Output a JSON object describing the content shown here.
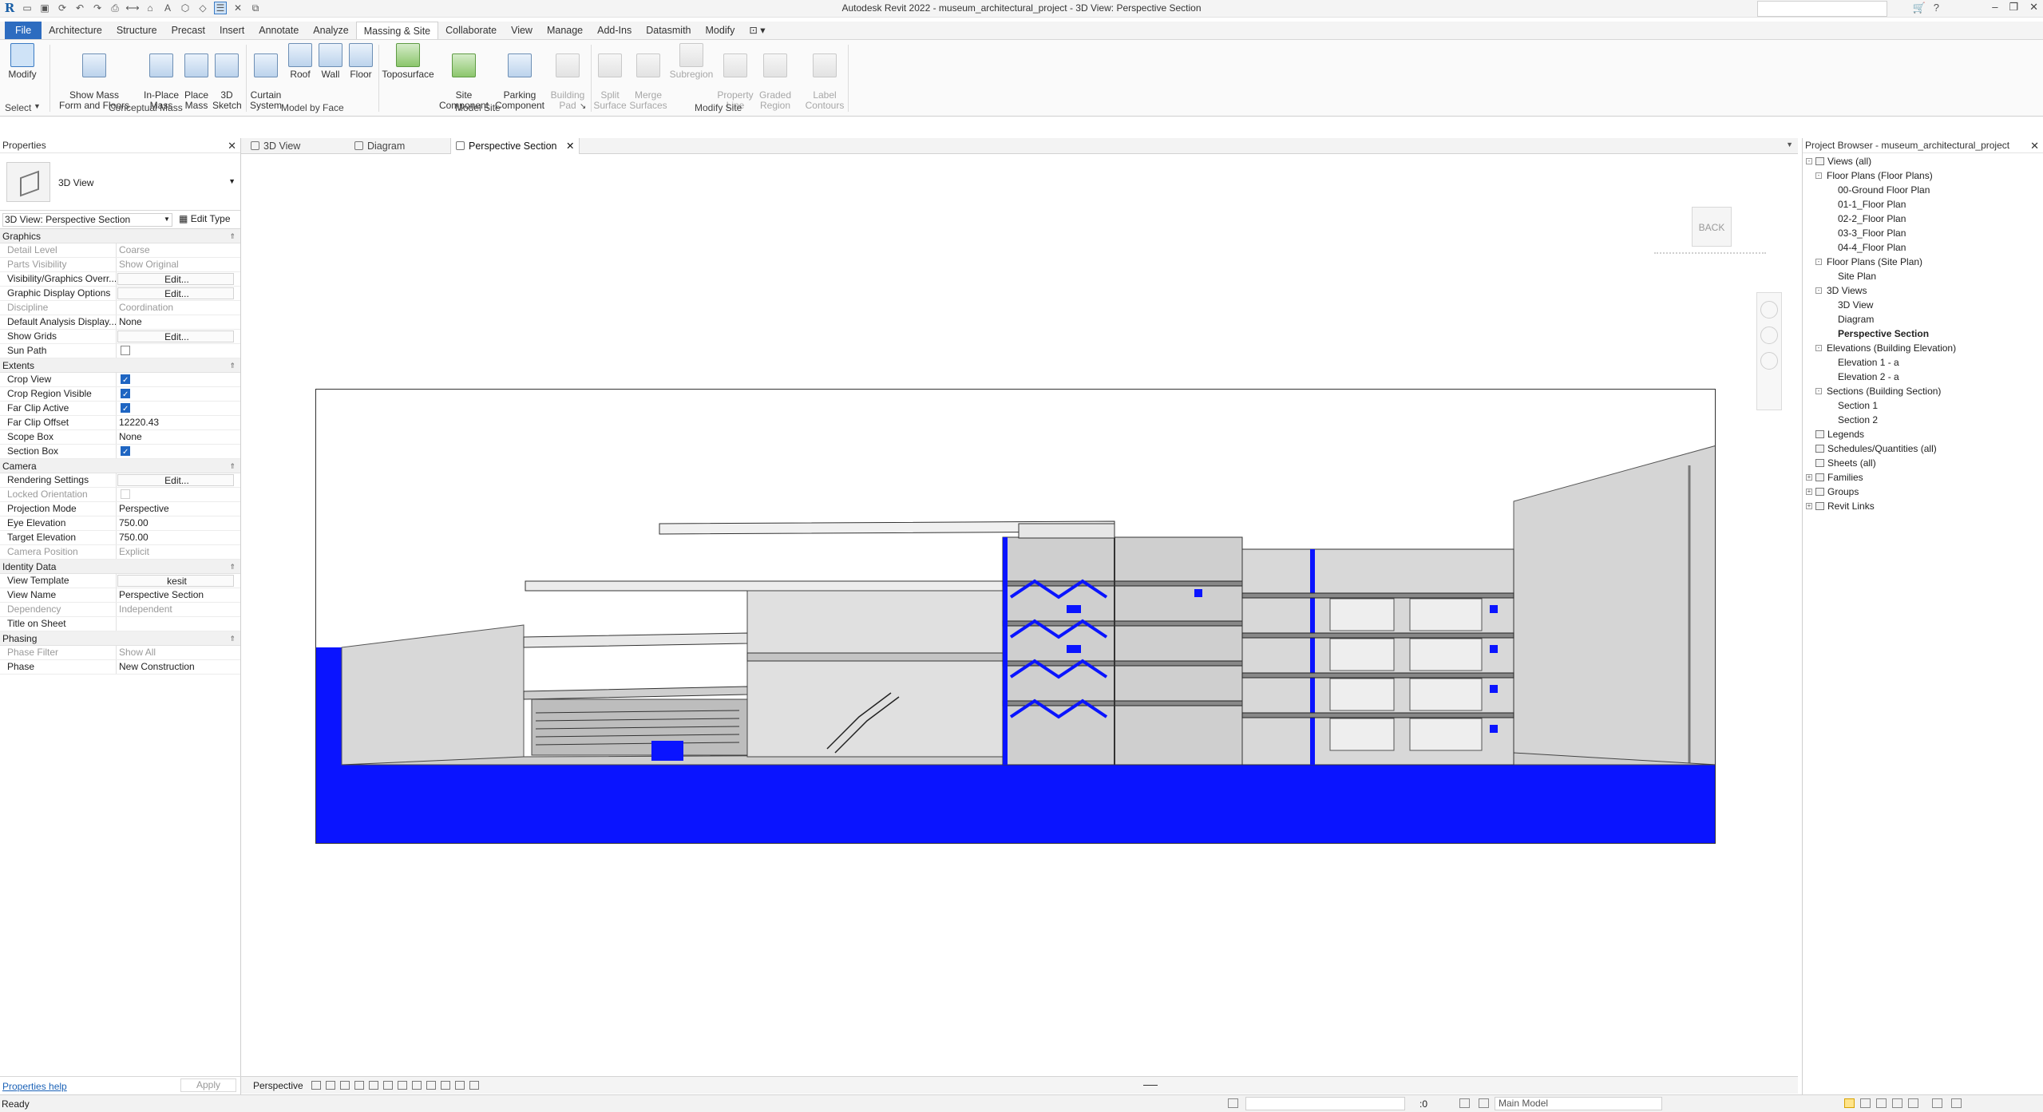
{
  "window": {
    "title": "Autodesk Revit 2022 - museum_architectural_project - 3D View: Perspective Section"
  },
  "menu": {
    "file": "File",
    "tabs": [
      "Architecture",
      "Structure",
      "Precast",
      "Insert",
      "Annotate",
      "Analyze",
      "Massing & Site",
      "Collaborate",
      "View",
      "Manage",
      "Add-Ins",
      "Datasmith",
      "Modify"
    ],
    "active": "Massing & Site"
  },
  "ribbon": {
    "modify": "Modify",
    "select": "Select",
    "conceptual_mass": {
      "label": "Conceptual Mass",
      "show_mass": "Show Mass\nForm and Floors",
      "in_place": "In-Place\nMass",
      "place_mass": "Place\nMass",
      "sketch3d": "3D\nSketch"
    },
    "model_by_face": {
      "label": "Model by Face",
      "curtain": "Curtain\nSystem",
      "roof": "Roof",
      "wall": "Wall",
      "floor": "Floor"
    },
    "model_site": {
      "label": "Model Site",
      "toposurface": "Toposurface",
      "site_component": "Site\nComponent",
      "parking": "Parking\nComponent",
      "building_pad": "Building\nPad"
    },
    "modify_site": {
      "label": "Modify Site",
      "split": "Split\nSurface",
      "merge": "Merge\nSurfaces",
      "subregion": "Subregion",
      "property_line": "Property\nLine",
      "graded": "Graded\nRegion",
      "label_contours": "Label\nContours"
    }
  },
  "properties": {
    "title": "Properties",
    "type_name": "3D View",
    "view_selector": "3D View: Perspective Section",
    "edit_type": "Edit Type",
    "groups": [
      {
        "name": "Graphics",
        "rows": [
          {
            "k": "Detail Level",
            "v": "Coarse",
            "dim": true
          },
          {
            "k": "Parts Visibility",
            "v": "Show Original",
            "dim": true
          },
          {
            "k": "Visibility/Graphics Overr...",
            "v": "Edit...",
            "btn": true
          },
          {
            "k": "Graphic Display Options",
            "v": "Edit...",
            "btn": true
          },
          {
            "k": "Discipline",
            "v": "Coordination",
            "dim": true
          },
          {
            "k": "Default Analysis Display...",
            "v": "None"
          },
          {
            "k": "Show Grids",
            "v": "Edit...",
            "btn": true
          },
          {
            "k": "Sun Path",
            "chk": "off"
          }
        ]
      },
      {
        "name": "Extents",
        "rows": [
          {
            "k": "Crop View",
            "chk": "on"
          },
          {
            "k": "Crop Region Visible",
            "chk": "on"
          },
          {
            "k": "Far Clip Active",
            "chk": "on"
          },
          {
            "k": "Far Clip Offset",
            "v": "12220.43"
          },
          {
            "k": "Scope Box",
            "v": "None"
          },
          {
            "k": "Section Box",
            "chk": "on"
          }
        ]
      },
      {
        "name": "Camera",
        "rows": [
          {
            "k": "Rendering Settings",
            "v": "Edit...",
            "btn": true
          },
          {
            "k": "Locked Orientation",
            "chk": "disabled",
            "dim": true
          },
          {
            "k": "Projection Mode",
            "v": "Perspective"
          },
          {
            "k": "Eye Elevation",
            "v": "750.00"
          },
          {
            "k": "Target Elevation",
            "v": "750.00"
          },
          {
            "k": "Camera Position",
            "v": "Explicit",
            "dim": true
          }
        ]
      },
      {
        "name": "Identity Data",
        "rows": [
          {
            "k": "View Template",
            "v": "kesit",
            "btn": true
          },
          {
            "k": "View Name",
            "v": "Perspective Section"
          },
          {
            "k": "Dependency",
            "v": "Independent",
            "dim": true
          },
          {
            "k": "Title on Sheet",
            "v": ""
          }
        ]
      },
      {
        "name": "Phasing",
        "rows": [
          {
            "k": "Phase Filter",
            "v": "Show All",
            "dim": true
          },
          {
            "k": "Phase",
            "v": "New Construction"
          }
        ]
      }
    ],
    "help": "Properties help",
    "apply": "Apply"
  },
  "tabs": [
    {
      "label": "3D View"
    },
    {
      "label": "Diagram"
    },
    {
      "label": "Perspective Section",
      "active": true
    }
  ],
  "canvas": {
    "viewcube": "BACK",
    "section_color": "#0a14ff"
  },
  "view_control": {
    "mode": "Perspective"
  },
  "browser": {
    "title": "Project Browser - museum_architectural_project",
    "nodes": [
      {
        "label": "Views (all)",
        "lvl": 0,
        "tog": "-",
        "icon": true
      },
      {
        "label": "Floor Plans (Floor Plans)",
        "lvl": 1,
        "tog": "-"
      },
      {
        "label": "00-Ground Floor Plan",
        "lvl": 2
      },
      {
        "label": "01-1_Floor Plan",
        "lvl": 2
      },
      {
        "label": "02-2_Floor Plan",
        "lvl": 2
      },
      {
        "label": "03-3_Floor Plan",
        "lvl": 2
      },
      {
        "label": "04-4_Floor Plan",
        "lvl": 2
      },
      {
        "label": "Floor Plans (Site Plan)",
        "lvl": 1,
        "tog": "-"
      },
      {
        "label": "Site Plan",
        "lvl": 2
      },
      {
        "label": "3D Views",
        "lvl": 1,
        "tog": "-"
      },
      {
        "label": "3D View",
        "lvl": 2
      },
      {
        "label": "Diagram",
        "lvl": 2
      },
      {
        "label": "Perspective Section",
        "lvl": 2,
        "sel": true
      },
      {
        "label": "Elevations (Building Elevation)",
        "lvl": 1,
        "tog": "-"
      },
      {
        "label": "Elevation 1 - a",
        "lvl": 2
      },
      {
        "label": "Elevation 2 - a",
        "lvl": 2
      },
      {
        "label": "Sections (Building Section)",
        "lvl": 1,
        "tog": "-"
      },
      {
        "label": "Section 1",
        "lvl": 2
      },
      {
        "label": "Section 2",
        "lvl": 2
      },
      {
        "label": "Legends",
        "lvl": 0,
        "icon": true
      },
      {
        "label": "Schedules/Quantities (all)",
        "lvl": 0,
        "icon": true
      },
      {
        "label": "Sheets (all)",
        "lvl": 0,
        "icon": true
      },
      {
        "label": "Families",
        "lvl": 0,
        "tog": "+",
        "icon": true
      },
      {
        "label": "Groups",
        "lvl": 0,
        "tog": "+",
        "icon": true
      },
      {
        "label": "Revit Links",
        "lvl": 0,
        "tog": "+",
        "icon": true
      }
    ]
  },
  "status": {
    "text": "Ready",
    "count": ":0",
    "model": "Main Model"
  }
}
